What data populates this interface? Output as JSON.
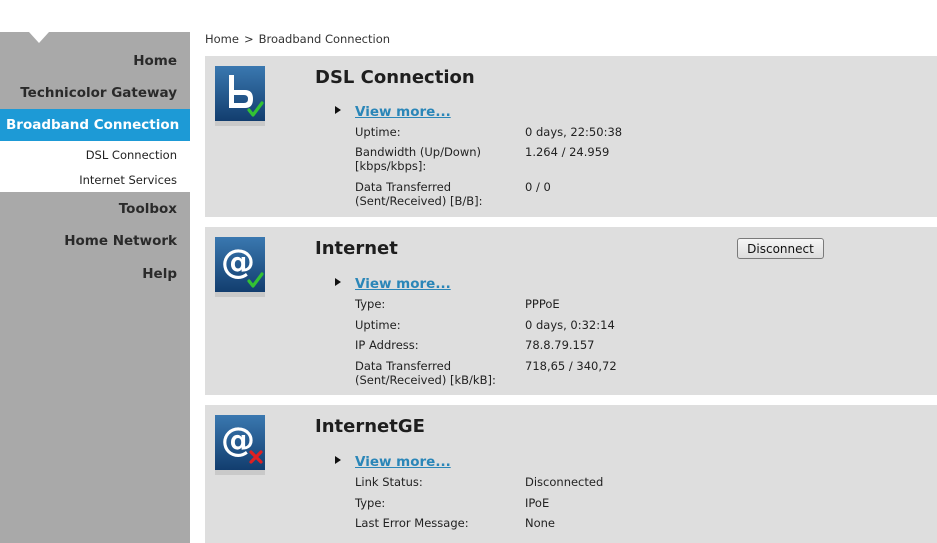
{
  "sidebar": {
    "items": [
      {
        "label": "Home"
      },
      {
        "label": "Technicolor Gateway"
      },
      {
        "label": "Broadband Connection"
      },
      {
        "label": "Toolbox"
      },
      {
        "label": "Home Network"
      },
      {
        "label": "Help"
      }
    ],
    "subitems": [
      {
        "label": "DSL Connection"
      },
      {
        "label": "Internet Services"
      }
    ]
  },
  "breadcrumb": {
    "home": "Home",
    "separator": ">",
    "current": "Broadband Connection"
  },
  "cards": [
    {
      "title": "DSL Connection",
      "icon": "broadband-check-icon",
      "more": "View more...",
      "rows": [
        {
          "label": "Uptime:",
          "value": "0 days, 22:50:38"
        },
        {
          "label": "Bandwidth (Up/Down) [kbps/kbps]:",
          "value": "1.264 / 24.959"
        },
        {
          "label": "Data Transferred (Sent/Received) [B/B]:",
          "value": "0 / 0"
        }
      ]
    },
    {
      "title": "Internet",
      "icon": "internet-check-icon",
      "more": "View more...",
      "button": "Disconnect",
      "rows": [
        {
          "label": "Type:",
          "value": "PPPoE"
        },
        {
          "label": "Uptime:",
          "value": "0 days, 0:32:14"
        },
        {
          "label": "IP Address:",
          "value": "78.8.79.157"
        },
        {
          "label": "Data Transferred (Sent/Received) [kB/kB]:",
          "value": "718,65 / 340,72"
        }
      ]
    },
    {
      "title": "InternetGE",
      "icon": "internet-error-icon",
      "more": "View more...",
      "rows": [
        {
          "label": "Link Status:",
          "value": "Disconnected"
        },
        {
          "label": "Type:",
          "value": "IPoE"
        },
        {
          "label": "Last Error Message:",
          "value": "None"
        }
      ]
    }
  ],
  "colors": {
    "accent": "#1d9ad6",
    "sidebar": "#a9a9a9",
    "card": "#dedede",
    "link": "#2a86b8",
    "ok": "#2db82d",
    "error": "#e02020"
  }
}
